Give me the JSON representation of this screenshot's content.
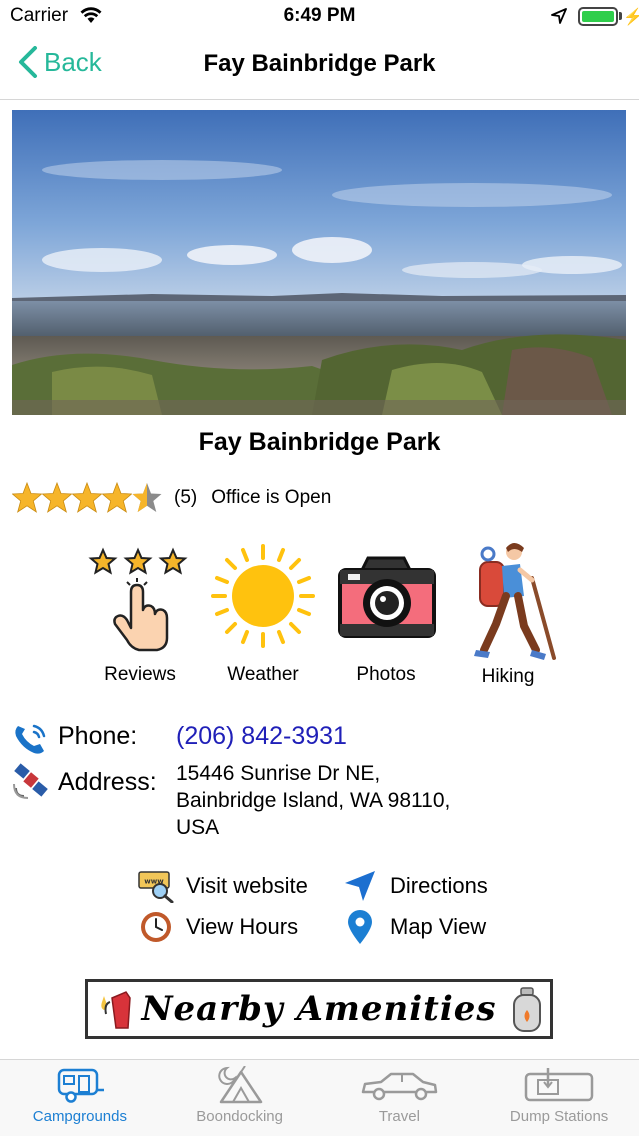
{
  "status_bar": {
    "carrier": "Carrier",
    "time": "6:49 PM"
  },
  "nav": {
    "back_label": "Back",
    "title": "Fay Bainbridge Park"
  },
  "park": {
    "name": "Fay Bainbridge Park",
    "rating": 4.5,
    "rating_max": 5,
    "review_count": "(5)",
    "office_status": "Office is Open"
  },
  "features": [
    {
      "label": "Reviews",
      "icon": "reviews-icon"
    },
    {
      "label": "Weather",
      "icon": "sun-icon"
    },
    {
      "label": "Photos",
      "icon": "camera-icon"
    },
    {
      "label": "Hiking",
      "icon": "hiker-icon"
    }
  ],
  "contact": {
    "phone_label": "Phone:",
    "phone": "(206) 842-3931",
    "address_label": "Address:",
    "address_lines": [
      "15446 Sunrise Dr NE,",
      "Bainbridge Island, WA 98110,",
      "USA"
    ]
  },
  "links": {
    "website": "Visit website",
    "directions": "Directions",
    "hours": "View Hours",
    "map": "Map View"
  },
  "amenities_banner": "Nearby Amenities",
  "tabs": [
    {
      "label": "Campgrounds",
      "active": true
    },
    {
      "label": "Boondocking",
      "active": false
    },
    {
      "label": "Travel",
      "active": false
    },
    {
      "label": "Dump Stations",
      "active": false
    }
  ],
  "colors": {
    "accent": "#26b89a",
    "tab_active": "#1c7fd3",
    "phone_link": "#2020b8",
    "star": "#f6b52a"
  }
}
